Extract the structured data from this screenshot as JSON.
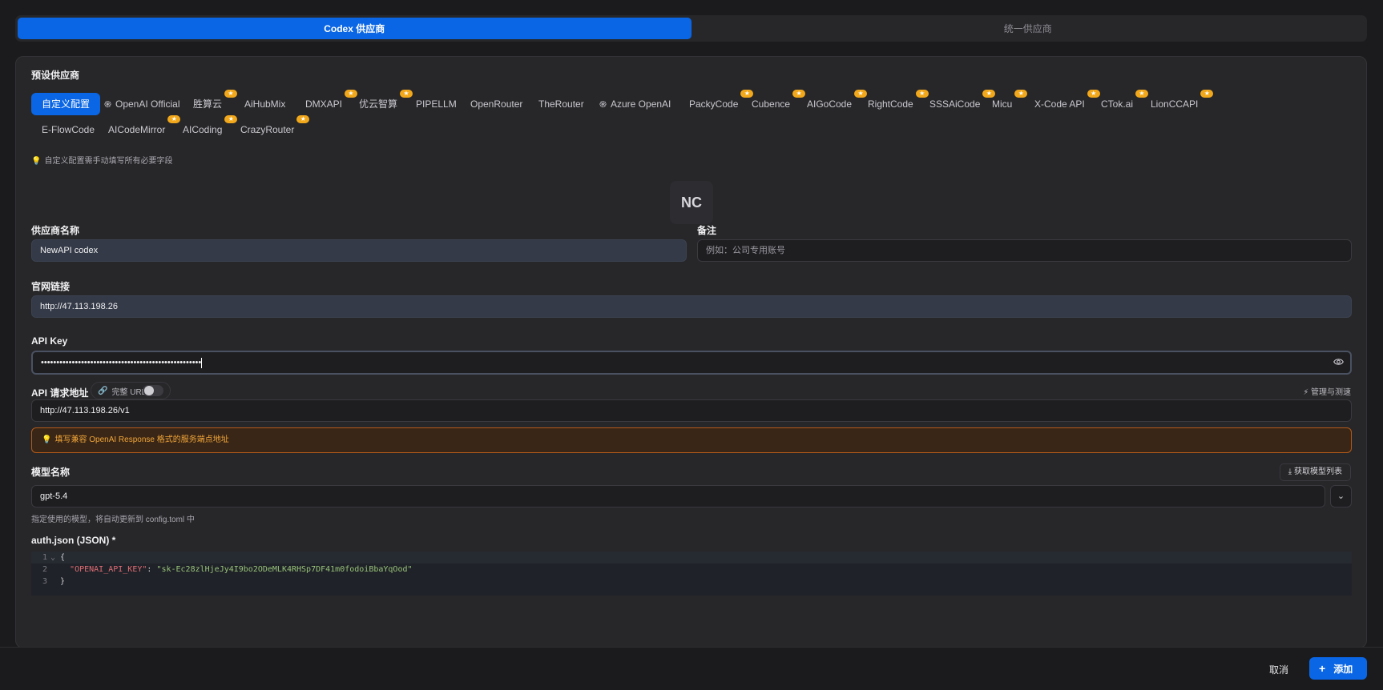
{
  "tabs": [
    {
      "label": "Codex 供应商"
    },
    {
      "label": "统一供应商"
    }
  ],
  "presets": {
    "title": "预设供应商",
    "row1": [
      {
        "label": "自定义配置",
        "active": true,
        "star": false,
        "icon": ""
      },
      {
        "label": "OpenAI Official",
        "active": false,
        "star": false,
        "icon": "openai-icon"
      },
      {
        "label": "胜算云",
        "active": false,
        "star": true,
        "icon": ""
      },
      {
        "label": "AiHubMix",
        "active": false,
        "star": false,
        "icon": ""
      },
      {
        "label": "DMXAPI",
        "active": false,
        "star": true,
        "icon": ""
      },
      {
        "label": "优云智算",
        "active": false,
        "star": true,
        "icon": ""
      },
      {
        "label": "PIPELLM",
        "active": false,
        "star": false,
        "icon": ""
      },
      {
        "label": "OpenRouter",
        "active": false,
        "star": false,
        "icon": ""
      },
      {
        "label": "TheRouter",
        "active": false,
        "star": false,
        "icon": ""
      },
      {
        "label": "Azure OpenAI",
        "active": false,
        "star": false,
        "icon": "openai-icon"
      },
      {
        "label": "PackyCode",
        "active": false,
        "star": true,
        "icon": ""
      },
      {
        "label": "Cubence",
        "active": false,
        "star": true,
        "icon": ""
      },
      {
        "label": "AIGoCode",
        "active": false,
        "star": true,
        "icon": ""
      },
      {
        "label": "RightCode",
        "active": false,
        "star": true,
        "icon": ""
      },
      {
        "label": "SSSAiCode",
        "active": false,
        "star": true,
        "icon": ""
      },
      {
        "label": "Micu",
        "active": false,
        "star": true,
        "icon": ""
      },
      {
        "label": "X-Code API",
        "active": false,
        "star": true,
        "icon": ""
      },
      {
        "label": "CTok.ai",
        "active": false,
        "star": true,
        "icon": ""
      },
      {
        "label": "LionCCAPI",
        "active": false,
        "star": true,
        "icon": ""
      }
    ],
    "row2": [
      {
        "label": "E-FlowCode",
        "active": false,
        "star": false,
        "icon": ""
      },
      {
        "label": "AICodeMirror",
        "active": false,
        "star": true,
        "icon": ""
      },
      {
        "label": "AICoding",
        "active": false,
        "star": true,
        "icon": ""
      },
      {
        "label": "CrazyRouter",
        "active": false,
        "star": true,
        "icon": ""
      }
    ],
    "hint": "自定义配置需手动填写所有必要字段"
  },
  "avatar": {
    "initials": "NC"
  },
  "form": {
    "name_label": "供应商名称",
    "name_value": "NewAPI codex",
    "note_label": "备注",
    "note_placeholder": "例如：公司专用账号",
    "website_label": "官网链接",
    "website_value": "http://47.113.198.26",
    "apikey_label": "API Key",
    "apikey_value": "••••••••••••••••••••••••••••••••••••••••••••••••••••",
    "endpoint_label": "API 请求地址",
    "full_url_label": "完整 URL",
    "full_url_on": false,
    "manage_label": "管理与测速",
    "endpoint_value": "http://47.113.198.26/v1",
    "endpoint_warning": "填写兼容 OpenAI Response 格式的服务端点地址",
    "model_label": "模型名称",
    "fetch_models_label": "获取模型列表",
    "model_value": "gpt-5.4",
    "model_help": "指定使用的模型，将自动更新到 config.toml 中",
    "auth_label": "auth.json (JSON) *",
    "auth_lines": [
      "{",
      "  \"OPENAI_API_KEY\": \"sk-Ec28zlHjeJy4I9bo2ODeMLK4RHSp7DF41m0fodoiBbaYqOod\"",
      "}"
    ],
    "auth_key": "\"OPENAI_API_KEY\"",
    "auth_value": "\"sk-Ec28zlHjeJy4I9bo2ODeMLK4RHSp7DF41m0fodoiBbaYqOod\""
  },
  "footer": {
    "cancel_label": "取消",
    "add_label": "添加"
  },
  "colors": {
    "accent": "#0a66e4",
    "star": "#f2a81b",
    "warning": "#f0a63a"
  }
}
